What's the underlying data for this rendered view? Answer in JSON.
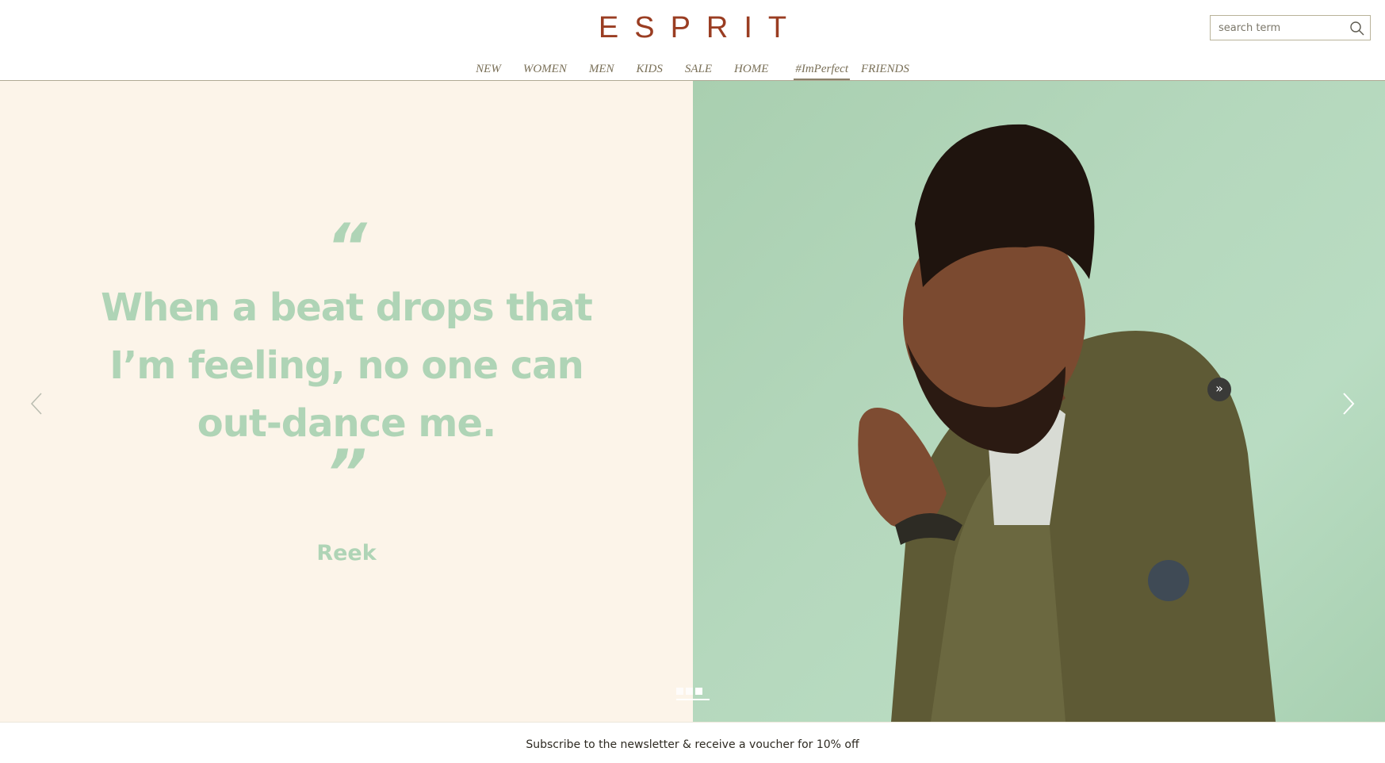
{
  "brand": {
    "logo_text": "ESPRIT",
    "logo_color": "#9a3d22"
  },
  "search": {
    "placeholder": "search term"
  },
  "nav": {
    "items": [
      {
        "label": "NEW"
      },
      {
        "label": "WOMEN"
      },
      {
        "label": "MEN"
      },
      {
        "label": "KIDS"
      },
      {
        "label": "SALE"
      },
      {
        "label": "HOME"
      },
      {
        "label": "#ImPerfect",
        "active": true
      },
      {
        "label": "FRIENDS"
      }
    ]
  },
  "hero": {
    "open_quote": "“",
    "close_quote": "”",
    "quote": "When a beat drops that I’m feeling, no one can out-dance me.",
    "author": "Reek",
    "left_bg": "#fcf4e9",
    "right_bg": "#b5d8bd",
    "accent_text_color": "#afd4b6",
    "next_badge": "»",
    "slides": {
      "count": 3
    }
  },
  "footer": {
    "newsletter_text": "Subscribe to the newsletter & receive a voucher for 10% off"
  }
}
